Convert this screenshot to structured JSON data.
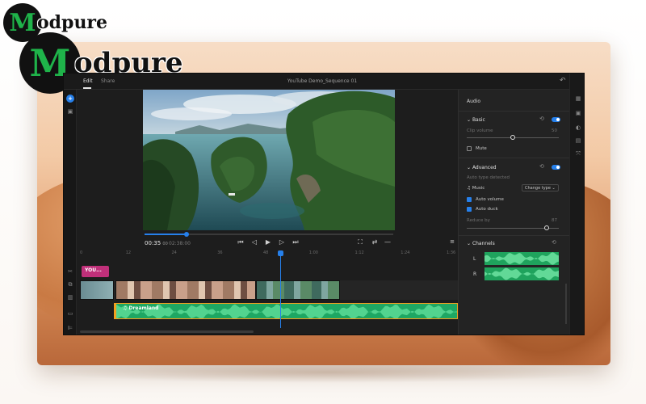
{
  "watermark": {
    "brand_letter": "M",
    "brand_rest": "odpure"
  },
  "app": {
    "tabs": [
      {
        "label": "Edit",
        "active": true
      },
      {
        "label": "Share",
        "active": false
      }
    ],
    "document_title": "YouTube Demo_Sequence 01",
    "icons": {
      "undo": "undo-icon",
      "comment": "comment-icon",
      "add": "plus-icon",
      "media": "media-icon"
    }
  },
  "player": {
    "current_time": "00:35",
    "current_time_frames": "00",
    "duration": "02:38:00",
    "progress": 0.17,
    "controls": [
      "skip-back-icon",
      "step-back-icon",
      "play-icon",
      "step-forward-icon",
      "skip-forward-icon"
    ],
    "right_controls": [
      "crop-icon",
      "loop-icon",
      "more-icon"
    ]
  },
  "timeline": {
    "ruler_ticks": [
      "0",
      "12",
      "24",
      "36",
      "48",
      "1:00",
      "1:12",
      "1:24",
      "1:36"
    ],
    "title_clip": "YOU...",
    "audio_clip_name": "Dreamland",
    "playhead_time_fraction": 0.53,
    "tools": [
      "scissors-icon",
      "duplicate-icon",
      "trash-icon",
      "caption-icon",
      "marker-icon"
    ]
  },
  "audio_panel": {
    "title": "Audio",
    "basic": {
      "label": "Basic",
      "clip_volume_label": "Clip volume",
      "clip_volume_value": "50",
      "clip_volume_fraction": 0.5,
      "mute_label": "Mute",
      "mute": false
    },
    "advanced": {
      "label": "Advanced",
      "sublabel": "Auto type detected",
      "type_label": "Music",
      "type_dropdown": "Change type",
      "auto_volume_label": "Auto volume",
      "auto_volume": true,
      "auto_duck_label": "Auto duck",
      "auto_duck": true,
      "reduce_by_label": "Reduce by",
      "reduce_by_value": "87",
      "reduce_by_fraction": 0.87
    },
    "channels": {
      "label": "Channels",
      "left": "L",
      "right": "R"
    }
  },
  "colors": {
    "accent": "#2680eb",
    "audio_green": "#1ea763",
    "title_clip": "#c0307a",
    "audio_border": "#f0a020"
  }
}
